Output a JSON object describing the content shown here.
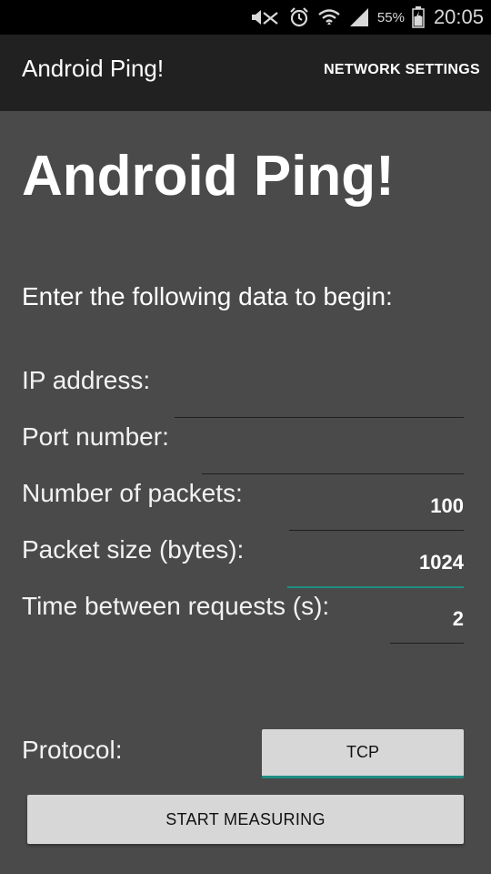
{
  "status_bar": {
    "icons": [
      "mute-icon",
      "alarm-icon",
      "wifi-icon",
      "signal-icon",
      "battery-icon"
    ],
    "battery_percent": "55%",
    "time": "20:05"
  },
  "app_bar": {
    "title": "Android Ping!",
    "action": "NETWORK SETTINGS"
  },
  "main": {
    "heading": "Android Ping!",
    "intro": "Enter the following data to begin:",
    "fields": [
      {
        "label": "IP address:",
        "value": ""
      },
      {
        "label": "Port number:",
        "value": ""
      },
      {
        "label": "Number of packets:",
        "value": "100"
      },
      {
        "label": "Packet size (bytes):",
        "value": "1024"
      },
      {
        "label": "Time between requests (s):",
        "value": "2"
      }
    ],
    "protocol_label": "Protocol:",
    "protocol_value": "TCP",
    "start_button": "START MEASURING"
  },
  "colors": {
    "background": "#4a4a4a",
    "app_bar": "#212121",
    "status_bar": "#000000",
    "accent": "#1e8f83",
    "button": "#d7d7d7"
  }
}
